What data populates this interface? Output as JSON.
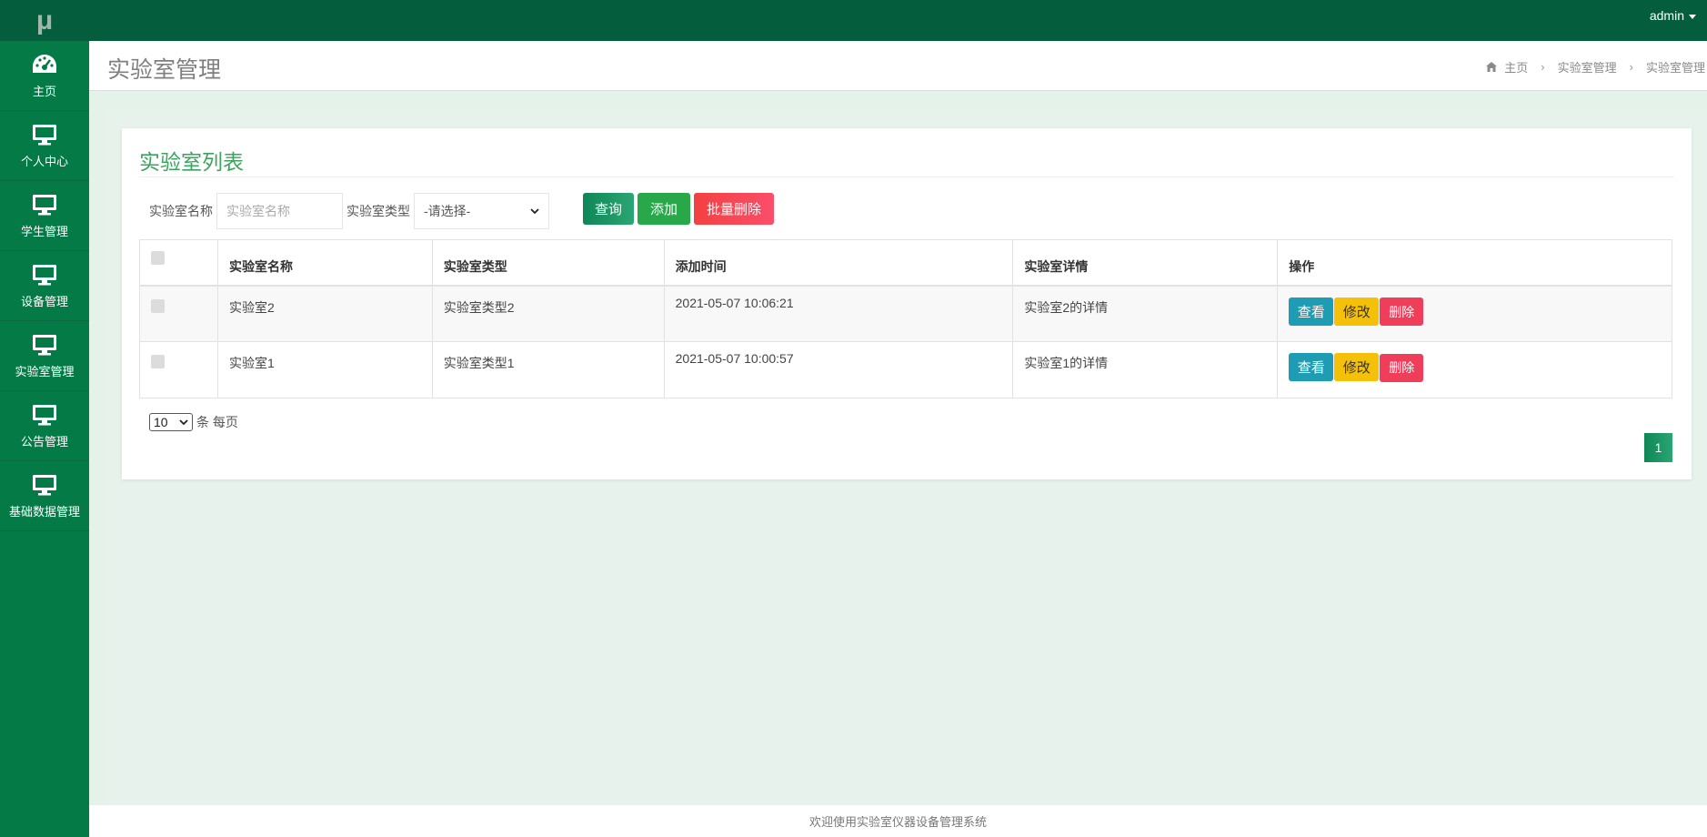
{
  "logo": {
    "text": "μ"
  },
  "sidebar": {
    "items": [
      {
        "label": "主页",
        "icon": "dashboard-icon"
      },
      {
        "label": "个人中心",
        "icon": "monitor-icon"
      },
      {
        "label": "学生管理",
        "icon": "monitor-icon"
      },
      {
        "label": "设备管理",
        "icon": "monitor-icon"
      },
      {
        "label": "实验室管理",
        "icon": "monitor-icon"
      },
      {
        "label": "公告管理",
        "icon": "monitor-icon"
      },
      {
        "label": "基础数据管理",
        "icon": "monitor-icon"
      }
    ]
  },
  "topbar": {
    "user": "admin"
  },
  "header": {
    "title": "实验室管理",
    "breadcrumb": [
      "主页",
      "实验室管理",
      "实验室管理"
    ]
  },
  "card": {
    "title": "实验室列表",
    "filters": {
      "name_label": "实验室名称",
      "name_placeholder": "实验室名称",
      "type_label": "实验室类型",
      "type_selected": "-请选择-"
    },
    "buttons": {
      "query": "查询",
      "add": "添加",
      "batch_delete": "批量删除"
    }
  },
  "table": {
    "headers": [
      "实验室名称",
      "实验室类型",
      "添加时间",
      "实验室详情",
      "操作"
    ],
    "rows": [
      {
        "name": "实验室2",
        "type": "实验室类型2",
        "time": "2021-05-07 10:06:21",
        "detail": "实验室2的详情"
      },
      {
        "name": "实验室1",
        "type": "实验室类型1",
        "time": "2021-05-07 10:00:57",
        "detail": "实验室1的详情"
      }
    ],
    "actions": {
      "view": "查看",
      "edit": "修改",
      "delete": "删除"
    }
  },
  "pagination": {
    "page_size": "10",
    "page_size_suffix": "条 每页",
    "current_page": "1"
  },
  "footer": {
    "text": "欢迎使用实验室仪器设备管理系统"
  },
  "colors": {
    "sidebar": "#047a47",
    "topbar": "#045e3e",
    "accent": "#3aa55d"
  }
}
